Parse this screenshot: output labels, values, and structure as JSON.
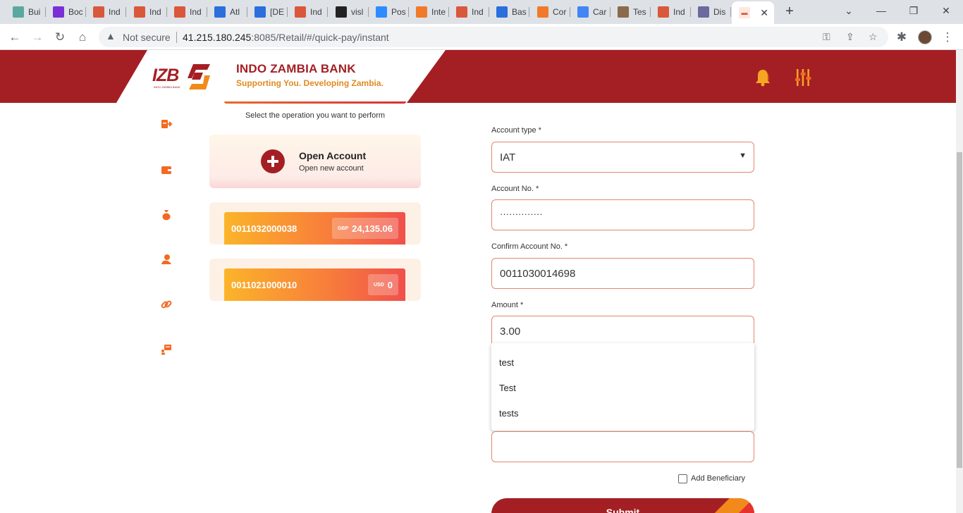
{
  "browser": {
    "tabs": [
      {
        "label": "Bui",
        "icon": "bookmark-icon",
        "color": "#5aa9a0"
      },
      {
        "label": "Boc",
        "icon": "p-logo-icon",
        "color": "#7b2fd6"
      },
      {
        "label": "Ind",
        "icon": "izb-favicon-icon",
        "color": "#d9583b"
      },
      {
        "label": "Ind",
        "icon": "izb-favicon-icon",
        "color": "#d9583b"
      },
      {
        "label": "Ind",
        "icon": "izb-favicon-icon",
        "color": "#d9583b"
      },
      {
        "label": "Atl",
        "icon": "atlassian-icon",
        "color": "#2a6fdb"
      },
      {
        "label": "[DE",
        "icon": "jira-icon",
        "color": "#2a6fdb"
      },
      {
        "label": "Ind",
        "icon": "izb-favicon-icon",
        "color": "#d9583b"
      },
      {
        "label": "visl",
        "icon": "github-icon",
        "color": "#222222"
      },
      {
        "label": "Pos",
        "icon": "zoom-icon",
        "color": "#2d8cff"
      },
      {
        "label": "Inte",
        "icon": "crown-icon",
        "color": "#f07a2a"
      },
      {
        "label": "Ind",
        "icon": "izb-favicon-icon",
        "color": "#d9583b"
      },
      {
        "label": "Bas",
        "icon": "atlassian-icon",
        "color": "#2a6fdb"
      },
      {
        "label": "Cor",
        "icon": "crown-icon",
        "color": "#f07a2a"
      },
      {
        "label": "Car",
        "icon": "google-icon",
        "color": "#4285f4"
      },
      {
        "label": "Tes",
        "icon": "person-icon",
        "color": "#8a6a4a"
      },
      {
        "label": "Ind",
        "icon": "izb-favicon-icon",
        "color": "#d9583b"
      },
      {
        "label": "Dis",
        "icon": "shield-icon",
        "color": "#6a6aa0"
      }
    ],
    "active_tab_icon": "izb-favicon-icon",
    "security_label": "Not secure",
    "url_host": "41.215.180.245",
    "url_rest": ":8085/Retail/#/quick-pay/instant"
  },
  "header": {
    "logo_text": "IZB",
    "logo_subtext": "INDO ZAMBIA BANK",
    "bank_name": "INDO ZAMBIA BANK",
    "tagline": "Supporting You. Developing Zambia."
  },
  "operations": {
    "hint": "Select the operation you want to perform",
    "open_account_title": "Open Account",
    "open_account_subtitle": "Open new account"
  },
  "accounts": [
    {
      "number": "0011032000038",
      "currency": "GBP",
      "balance": "24,135.06"
    },
    {
      "number": "0011021000010",
      "currency": "USD",
      "balance": "0"
    }
  ],
  "form": {
    "account_type_label": "Account type *",
    "account_type_value": "IAT",
    "account_no_label": "Account No. *",
    "account_no_value": "··············",
    "confirm_label": "Confirm Account No. *",
    "confirm_value": "0011030014698",
    "amount_label": "Amount *",
    "amount_value": "3.00",
    "suggestions": [
      "test",
      "Test",
      "tests"
    ],
    "add_beneficiary_label": "Add Beneficiary",
    "submit_label": "Submit"
  },
  "colors": {
    "brand_red": "#a41f24",
    "brand_orange": "#e08b1f",
    "accent_orange": "#f26a21"
  }
}
